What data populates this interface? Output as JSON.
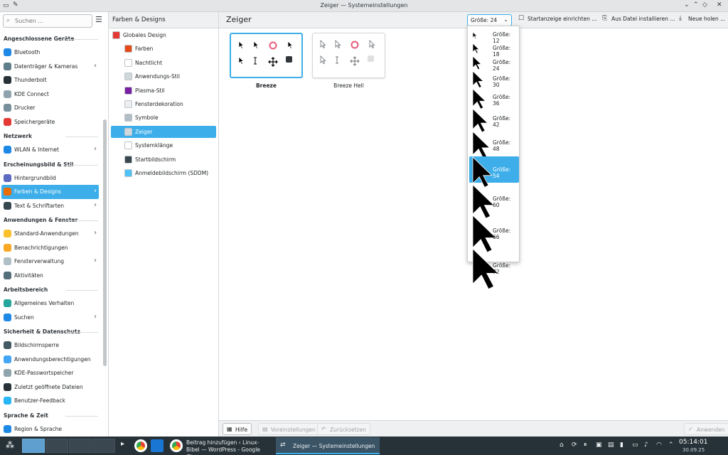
{
  "window": {
    "title": "Zeiger — Systemeinstellungen",
    "controls": [
      "⌄",
      "⌃",
      "◇",
      "✕"
    ]
  },
  "sidebar": {
    "search_placeholder": "Suchen ...",
    "sections": [
      {
        "title": "Angeschlossene Geräte",
        "items": [
          {
            "label": "Bluetooth",
            "color": "#1e88e5",
            "arrow": false
          },
          {
            "label": "Datenträger & Kameras",
            "color": "#607d8b",
            "arrow": true
          },
          {
            "label": "Thunderbolt",
            "color": "#263238",
            "arrow": false
          },
          {
            "label": "KDE Connect",
            "color": "#90a4ae",
            "arrow": false
          },
          {
            "label": "Drucker",
            "color": "#78909c",
            "arrow": false
          },
          {
            "label": "Speichergeräte",
            "color": "#e53935",
            "arrow": false
          }
        ]
      },
      {
        "title": "Netzwerk",
        "items": [
          {
            "label": "WLAN & Internet",
            "color": "#1e88e5",
            "arrow": true
          }
        ]
      },
      {
        "title": "Erscheinungsbild & Stil",
        "items": [
          {
            "label": "Hintergrundbild",
            "color": "#5c6bc0",
            "arrow": false
          },
          {
            "label": "Farben & Designs",
            "color": "#ef6c00",
            "arrow": true,
            "active": true
          },
          {
            "label": "Text & Schriftarten",
            "color": "#37474f",
            "arrow": true
          }
        ]
      },
      {
        "title": "Anwendungen & Fenster",
        "items": [
          {
            "label": "Standard-Anwendungen",
            "color": "#fbc02d",
            "arrow": true
          },
          {
            "label": "Benachrichtigungen",
            "color": "#f9a825",
            "arrow": false
          },
          {
            "label": "Fensterverwaltung",
            "color": "#b0bec5",
            "arrow": true
          },
          {
            "label": "Aktivitäten",
            "color": "#546e7a",
            "arrow": false
          }
        ]
      },
      {
        "title": "Arbeitsbereich",
        "items": [
          {
            "label": "Allgemeines Verhalten",
            "color": "#26a69a",
            "arrow": false
          },
          {
            "label": "Suchen",
            "color": "#1e88e5",
            "arrow": true
          }
        ]
      },
      {
        "title": "Sicherheit & Datenschutz",
        "items": [
          {
            "label": "Bildschirmsperre",
            "color": "#455a64",
            "arrow": false
          },
          {
            "label": "Anwendungsberechtigungen",
            "color": "#42a5f5",
            "arrow": false
          },
          {
            "label": "KDE-Passwortspeicher",
            "color": "#90a4ae",
            "arrow": false
          },
          {
            "label": "Zuletzt geöffnete Dateien",
            "color": "#263238",
            "arrow": false
          },
          {
            "label": "Benutzer-Feedback",
            "color": "#29b6f6",
            "arrow": false
          }
        ]
      },
      {
        "title": "Sprache & Zeit",
        "items": [
          {
            "label": "Region & Sprache",
            "color": "#1e88e5",
            "arrow": false
          }
        ]
      }
    ]
  },
  "middle": {
    "title": "Farben & Designs",
    "items": [
      {
        "label": "Globales Design",
        "color": "#e53935",
        "level": 0
      },
      {
        "label": "Farben",
        "color": "#e64a19",
        "level": 1
      },
      {
        "label": "Nachtlicht",
        "color": "#ffffff",
        "level": 1
      },
      {
        "label": "Anwendungs-Stil",
        "color": "#cfd8dc",
        "level": 1
      },
      {
        "label": "Plasma-Stil",
        "color": "#7b1fa2",
        "level": 1
      },
      {
        "label": "Fensterdekoration",
        "color": "#eceff1",
        "level": 1
      },
      {
        "label": "Symbole",
        "color": "#b0bec5",
        "level": 1
      },
      {
        "label": "Zeiger",
        "color": "#cfd8dc",
        "level": 1,
        "active": true
      },
      {
        "label": "Systemklänge",
        "color": "#ffffff",
        "level": 1
      },
      {
        "label": "Startbildschirm",
        "color": "#37474f",
        "level": 1
      },
      {
        "label": "Anmeldebildschirm (SDDM)",
        "color": "#4fc3f7",
        "level": 1
      }
    ]
  },
  "main": {
    "title": "Zeiger",
    "size_selected": "Größe: 24",
    "header_buttons": [
      {
        "label": "Startanzeige einrichten ...",
        "icon": "☐"
      },
      {
        "label": "Aus Datei installieren ...",
        "icon": "⎘"
      },
      {
        "label": "Neue holen ...",
        "icon": "⤓"
      }
    ],
    "themes": [
      {
        "name": "Breeze",
        "selected": true,
        "tone": "#000000"
      },
      {
        "name": "Breeze Hell",
        "selected": false,
        "tone": "#ffffff"
      }
    ]
  },
  "size_options": [
    {
      "label": "Größe: 12",
      "size": 12
    },
    {
      "label": "Größe: 18",
      "size": 18
    },
    {
      "label": "Größe: 24",
      "size": 24
    },
    {
      "label": "Größe: 30",
      "size": 30
    },
    {
      "label": "Größe: 36",
      "size": 36
    },
    {
      "label": "Größe: 42",
      "size": 42
    },
    {
      "label": "Größe: 48",
      "size": 48
    },
    {
      "label": "Größe: 54",
      "size": 54,
      "active": true
    },
    {
      "label": "Größe: 60",
      "size": 60
    },
    {
      "label": "Größe: 66",
      "size": 66
    },
    {
      "label": "Größe: 72",
      "size": 72
    }
  ],
  "bottom": {
    "help": "Hilfe",
    "defaults": "Voreinstellungen",
    "reset": "Zurücksetzen",
    "apply": "Anwenden"
  },
  "taskbar": {
    "tasks": [
      {
        "label": "Beitrag hinzufügen ‹ Linux-Bibel — WordPress - Google Chrome",
        "active": false
      },
      {
        "label": "Zeiger — Systemeinstellungen",
        "active": true
      }
    ],
    "time": "05:14:01",
    "date": "30.09.25"
  }
}
